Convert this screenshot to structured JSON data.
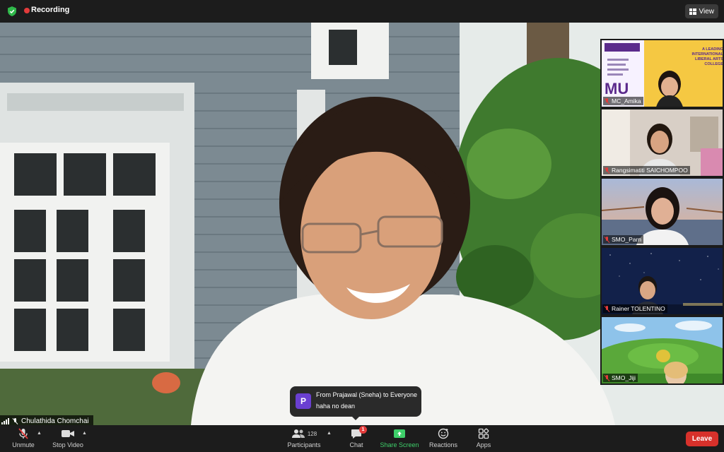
{
  "meeting": {
    "recording_label": "Recording",
    "view_label": "View",
    "active_speaker": "Chulathida Chomchai"
  },
  "chat_toast": {
    "avatar_letter": "P",
    "from": "From Prajawal (Sneha) to Everyone",
    "message": "haha no dean"
  },
  "gallery": [
    {
      "name": "MC_Amika",
      "muted": true
    },
    {
      "name": "Rangsimatiti SAICHOMPOO",
      "muted": true
    },
    {
      "name": "SMO_Parn",
      "muted": true
    },
    {
      "name": "Rainer TOLENTINO",
      "muted": true
    },
    {
      "name": "SMO_Jiji",
      "muted": true
    }
  ],
  "tile1_slide": {
    "headline_1": "A LEADING",
    "headline_2": "INTERNATIONAL",
    "headline_3": "LIBERAL ARTS",
    "headline_4": "COLLEGE",
    "logo_text": "MU"
  },
  "toolbar": {
    "unmute": "Unmute",
    "stop_video": "Stop Video",
    "participants": "Participants",
    "participants_count": "128",
    "chat": "Chat",
    "chat_badge": "1",
    "share_screen": "Share Screen",
    "reactions": "Reactions",
    "apps": "Apps",
    "leave": "Leave"
  },
  "colors": {
    "leave": "#d7312b",
    "share": "#3ecf6a",
    "muted_icon": "#e33b3b",
    "chat_avatar": "#6a3fd1",
    "slide_bg": "#f5c842"
  }
}
